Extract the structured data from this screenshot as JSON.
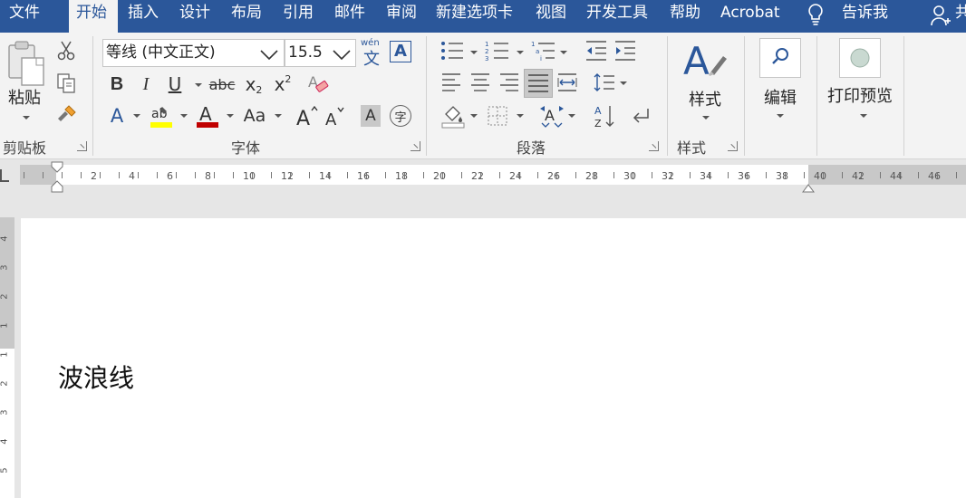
{
  "tabs": [
    {
      "label": "文件",
      "active": false
    },
    {
      "label": "开始",
      "active": true
    },
    {
      "label": "插入",
      "active": false
    },
    {
      "label": "设计",
      "active": false
    },
    {
      "label": "布局",
      "active": false
    },
    {
      "label": "引用",
      "active": false
    },
    {
      "label": "邮件",
      "active": false
    },
    {
      "label": "审阅",
      "active": false
    },
    {
      "label": "新建选项卡",
      "active": false
    },
    {
      "label": "视图",
      "active": false
    },
    {
      "label": "开发工具",
      "active": false
    },
    {
      "label": "帮助",
      "active": false
    },
    {
      "label": "Acrobat",
      "active": false
    }
  ],
  "tell_me": "告诉我",
  "share": "共",
  "clipboard": {
    "paste_label": "粘贴",
    "group_label": "剪贴板"
  },
  "font": {
    "name": "等线 (中文正文)",
    "size": "15.5",
    "group_label": "字体",
    "phonetic_top": "wén",
    "phonetic_bottom": "文",
    "aa_label": "Aa",
    "clear_label": "字"
  },
  "paragraph": {
    "group_label": "段落"
  },
  "styles": {
    "button_label": "样式",
    "group_label": "样式"
  },
  "editing": {
    "button_label": "编辑"
  },
  "print_preview": {
    "button_label": "打印预览"
  },
  "ruler": {
    "ticks": [
      "2",
      "4",
      "6",
      "8",
      "10",
      "12",
      "14",
      "16",
      "18",
      "20",
      "22",
      "24",
      "26",
      "28",
      "30",
      "32",
      "34",
      "36",
      "38",
      "40",
      "42",
      "44",
      "46"
    ],
    "vticks": [
      "4",
      "3",
      "2",
      "1",
      "1",
      "2",
      "3",
      "4",
      "5"
    ]
  },
  "document": {
    "text": "波浪线"
  },
  "colors": {
    "accent": "#2b579a",
    "highlight": "#ffff00",
    "font_color": "#c00000"
  }
}
